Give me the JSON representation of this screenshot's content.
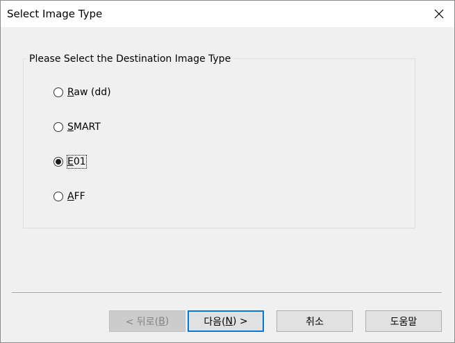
{
  "window": {
    "title": "Select Image Type"
  },
  "group": {
    "legend": "Please Select the Destination Image Type",
    "options": [
      {
        "mnemonic": "R",
        "rest": "aw (dd)",
        "checked": false
      },
      {
        "mnemonic": "S",
        "rest": "MART",
        "checked": false
      },
      {
        "mnemonic": "E",
        "rest": "01",
        "checked": true
      },
      {
        "mnemonic": "A",
        "rest": "FF",
        "checked": false
      }
    ]
  },
  "buttons": {
    "back": {
      "prefix": "< 뒤로(",
      "mnemonic": "B",
      "suffix": ")",
      "enabled": false
    },
    "next": {
      "prefix": "다음(",
      "mnemonic": "N",
      "suffix": ") >",
      "enabled": true
    },
    "cancel": {
      "label": "취소"
    },
    "help": {
      "label": "도움말"
    }
  },
  "icons": {
    "close": "close-icon"
  }
}
